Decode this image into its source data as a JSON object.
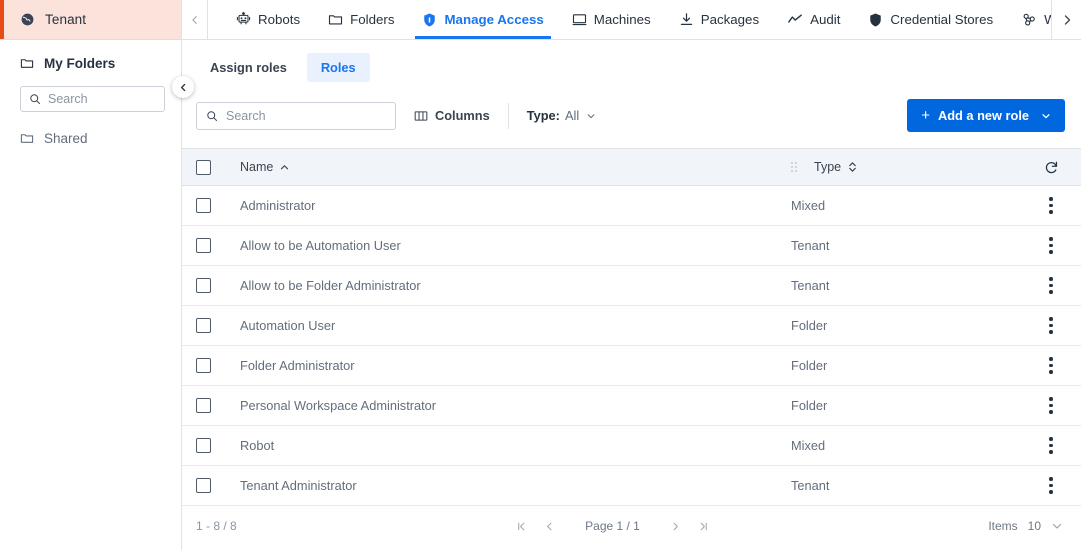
{
  "sidebar": {
    "tenant": {
      "label": "Tenant",
      "icon": "globe-icon"
    },
    "items": [
      {
        "label": "My Folders",
        "icon": "folder-icon",
        "emphasis": "strong"
      },
      {
        "label": "Shared",
        "icon": "folder-icon",
        "emphasis": "muted"
      }
    ],
    "search": {
      "placeholder": "Search",
      "value": "",
      "icon": "search-icon"
    },
    "collapse": {
      "icon": "chevron-left-icon"
    }
  },
  "topnav": {
    "scroll_left": "‹",
    "scroll_right": "›",
    "tabs": [
      {
        "label": "Robots",
        "icon": "robot-icon",
        "active": false
      },
      {
        "label": "Folders",
        "icon": "folder-icon",
        "active": false
      },
      {
        "label": "Manage Access",
        "icon": "shield-icon",
        "active": true
      },
      {
        "label": "Machines",
        "icon": "monitor-icon",
        "active": false
      },
      {
        "label": "Packages",
        "icon": "download-icon",
        "active": false
      },
      {
        "label": "Audit",
        "icon": "trend-icon",
        "active": false
      },
      {
        "label": "Credential Stores",
        "icon": "shield-filled-icon",
        "active": false
      },
      {
        "label": "Webhoo",
        "icon": "webhook-icon",
        "active": false
      }
    ]
  },
  "subtabs": [
    {
      "label": "Assign roles",
      "active": false
    },
    {
      "label": "Roles",
      "active": true
    }
  ],
  "toolbar": {
    "search": {
      "placeholder": "Search",
      "value": "",
      "icon": "search-icon"
    },
    "columns_label": "Columns",
    "columns_icon": "columns-icon",
    "filter_key": "Type:",
    "filter_value": "All",
    "filter_icon": "chevron-down-icon",
    "add_label": "Add a new role",
    "add_plus": "+",
    "add_caret": "chevron-down-icon",
    "accent_color": "#0067df"
  },
  "table": {
    "columns": [
      {
        "label": "Name",
        "sort": "asc",
        "sort_glyph": "▴"
      },
      {
        "label": "Type",
        "sort": "none",
        "sort_glyph": "⇅"
      }
    ],
    "refresh_icon": "refresh-icon",
    "row_menu_icon": "more-vertical-icon",
    "rows": [
      {
        "name": "Administrator",
        "type": "Mixed"
      },
      {
        "name": "Allow to be Automation User",
        "type": "Tenant"
      },
      {
        "name": "Allow to be Folder Administrator",
        "type": "Tenant"
      },
      {
        "name": "Automation User",
        "type": "Folder"
      },
      {
        "name": "Folder Administrator",
        "type": "Folder"
      },
      {
        "name": "Personal Workspace Administrator",
        "type": "Folder"
      },
      {
        "name": "Robot",
        "type": "Mixed"
      },
      {
        "name": "Tenant Administrator",
        "type": "Tenant"
      }
    ]
  },
  "footer": {
    "range": "1 - 8 / 8",
    "first": "|‹",
    "prev": "‹",
    "page": "Page 1 / 1",
    "next": "›",
    "last": "›|",
    "items_label": "Items",
    "items_value": "10"
  }
}
